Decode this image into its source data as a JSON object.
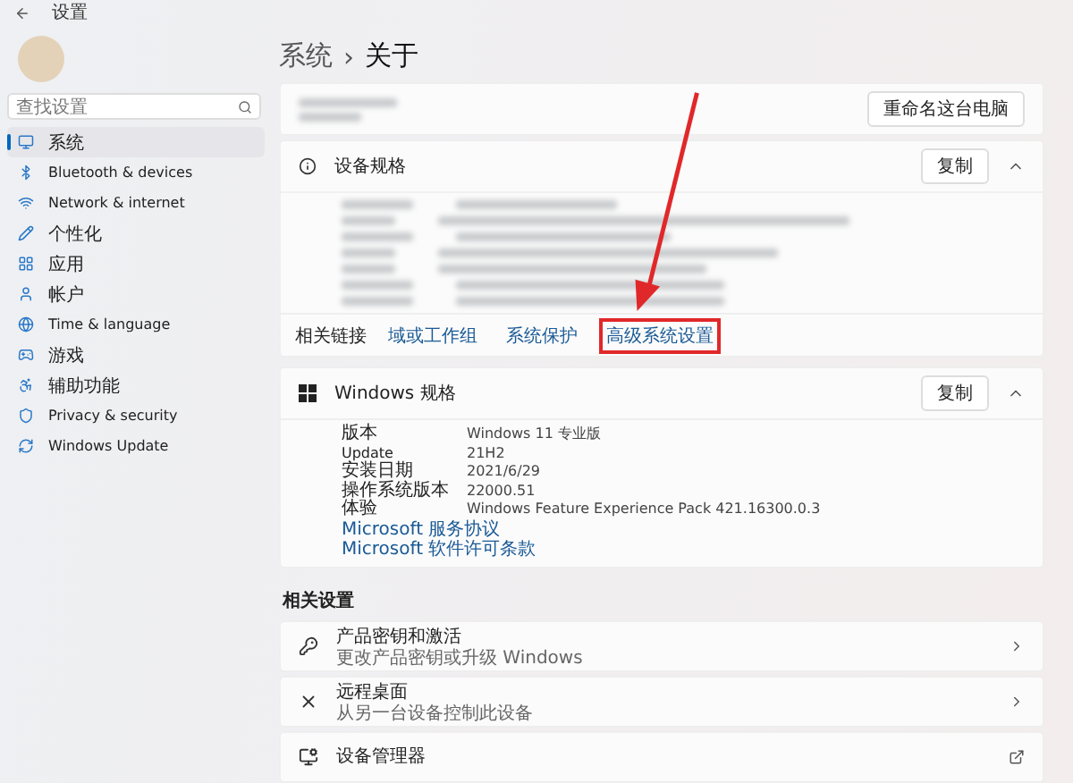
{
  "window": {
    "title": "设置"
  },
  "sidebar": {
    "search": {
      "placeholder": "查找设置"
    },
    "items": [
      {
        "label": "系统",
        "selected": true
      },
      {
        "label": "Bluetooth & devices",
        "selected": false
      },
      {
        "label": "Network & internet",
        "selected": false
      },
      {
        "label": "个性化",
        "selected": false
      },
      {
        "label": "应用",
        "selected": false
      },
      {
        "label": "帐户",
        "selected": false
      },
      {
        "label": "Time & language",
        "selected": false
      },
      {
        "label": "游戏",
        "selected": false
      },
      {
        "label": "辅助功能",
        "selected": false
      },
      {
        "label": "Privacy & security",
        "selected": false
      },
      {
        "label": "Windows Update",
        "selected": false
      }
    ]
  },
  "breadcrumb": {
    "parent": "系统",
    "separator": "›",
    "current": "关于"
  },
  "rename_button": "重命名这台电脑",
  "device_spec": {
    "title": "设备规格",
    "copy_button": "复制",
    "expanded": true
  },
  "related_links": {
    "label": "相关链接",
    "links": [
      {
        "label": "域或工作组",
        "highlighted": false
      },
      {
        "label": "系统保护",
        "highlighted": false
      },
      {
        "label": "高级系统设置",
        "highlighted": true
      }
    ]
  },
  "windows_spec": {
    "title": "Windows 规格",
    "copy_button": "复制",
    "expanded": true,
    "rows": [
      {
        "label": "版本",
        "value": "Windows 11 专业版"
      },
      {
        "label": "Update",
        "value": "21H2"
      },
      {
        "label": "安装日期",
        "value": "2021/6/29"
      },
      {
        "label": "操作系统版本",
        "value": "22000.51"
      },
      {
        "label": "体验",
        "value": "Windows Feature Experience Pack 421.16300.0.3"
      }
    ],
    "links": [
      "Microsoft 服务协议",
      "Microsoft 软件许可条款"
    ]
  },
  "related_settings": {
    "title": "相关设置",
    "items": [
      {
        "kind": "chevron",
        "title": "产品密钥和激活",
        "subtitle": "更改产品密钥或升级 Windows"
      },
      {
        "kind": "chevron",
        "title": "远程桌面",
        "subtitle": "从另一台设备控制此设备"
      },
      {
        "kind": "external",
        "title": "设备管理器"
      }
    ]
  }
}
